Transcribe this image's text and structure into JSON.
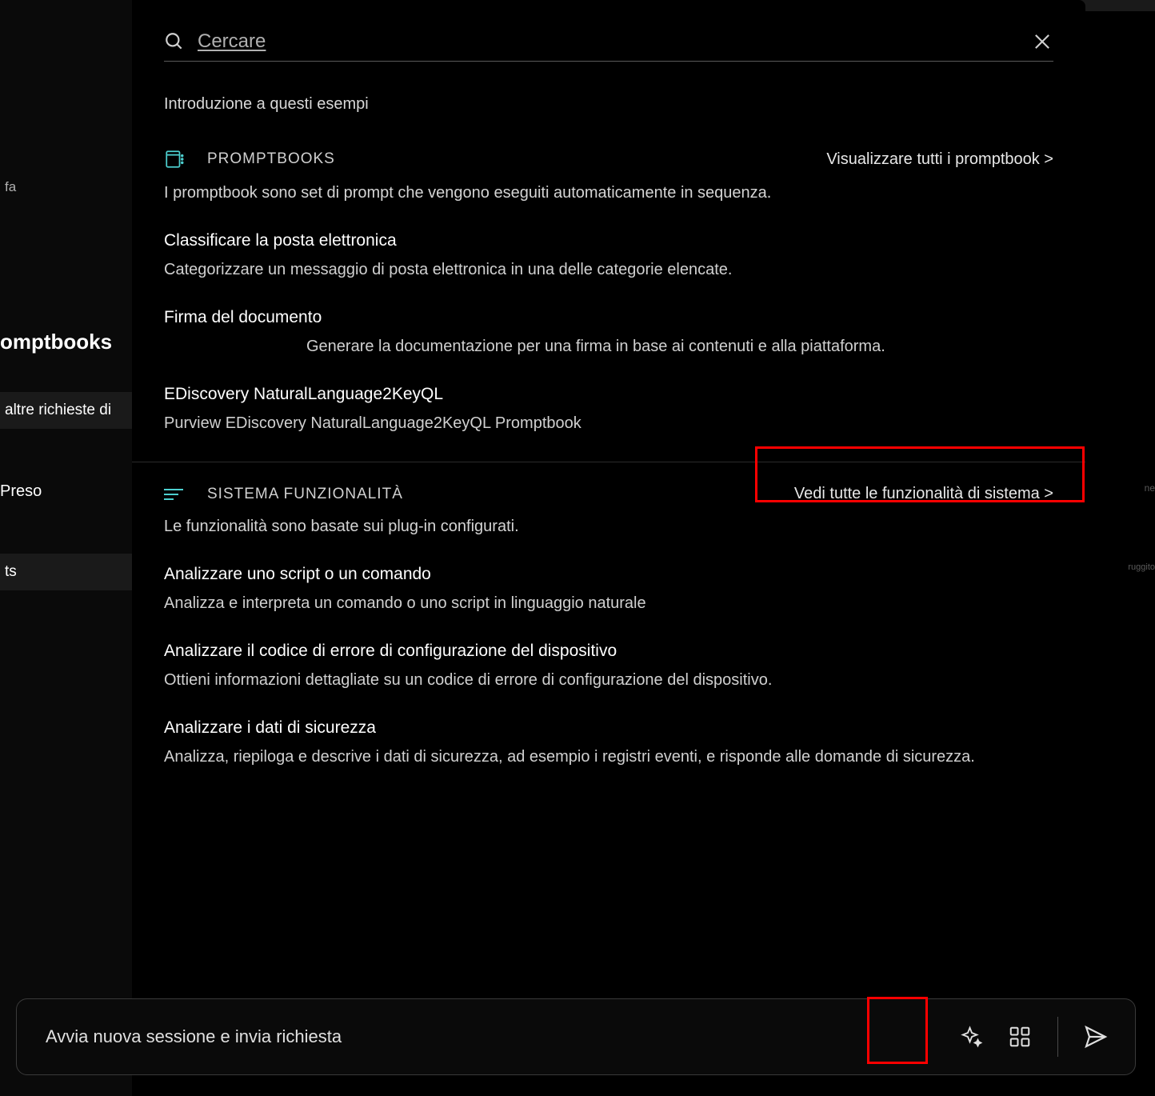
{
  "sidebar": {
    "fa": "fa",
    "promptbooks": "omptbooks",
    "altre": "altre richieste di",
    "preso": "Preso",
    "ts": "ts"
  },
  "rightFragments": {
    "f1": "ne",
    "f2": "ruggito"
  },
  "search": {
    "placeholder": "Cercare"
  },
  "intro": "Introduzione a questi esempi",
  "promptbooks": {
    "title": "PROMPTBOOKS",
    "viewAll": "Visualizzare tutti i promptbook &gt;",
    "desc": "I promptbook sono set di prompt che vengono eseguiti automaticamente in sequenza.",
    "items": [
      {
        "title": "Classificare la posta elettronica",
        "desc": "Categorizzare un messaggio di posta elettronica in una delle categorie elencate."
      },
      {
        "title": "Firma del documento",
        "desc": "Generare la documentazione per una firma in base ai contenuti e alla piattaforma."
      },
      {
        "title": "EDiscovery NaturalLanguage2KeyQL",
        "desc": "Purview EDiscovery NaturalLanguage2KeyQL Promptbook"
      }
    ]
  },
  "system": {
    "title": "SISTEMA   FUNZIONALITÀ",
    "viewAll": "Vedi tutte le funzionalità di sistema &gt;",
    "desc": "Le funzionalità sono basate sui plug-in configurati.",
    "items": [
      {
        "title": "Analizzare uno script o un comando",
        "desc": "Analizza e interpreta un comando o uno script in linguaggio naturale"
      },
      {
        "title": "Analizzare il codice di errore di configurazione del dispositivo",
        "desc": "Ottieni informazioni dettagliate su un codice di errore di configurazione del dispositivo."
      },
      {
        "title": "Analizzare i dati di sicurezza",
        "desc": "Analizza, riepiloga e descrive i dati di sicurezza, ad esempio i registri eventi, e risponde alle domande di sicurezza."
      }
    ]
  },
  "promptBar": {
    "text": "Avvia nuova sessione e invia richiesta"
  }
}
